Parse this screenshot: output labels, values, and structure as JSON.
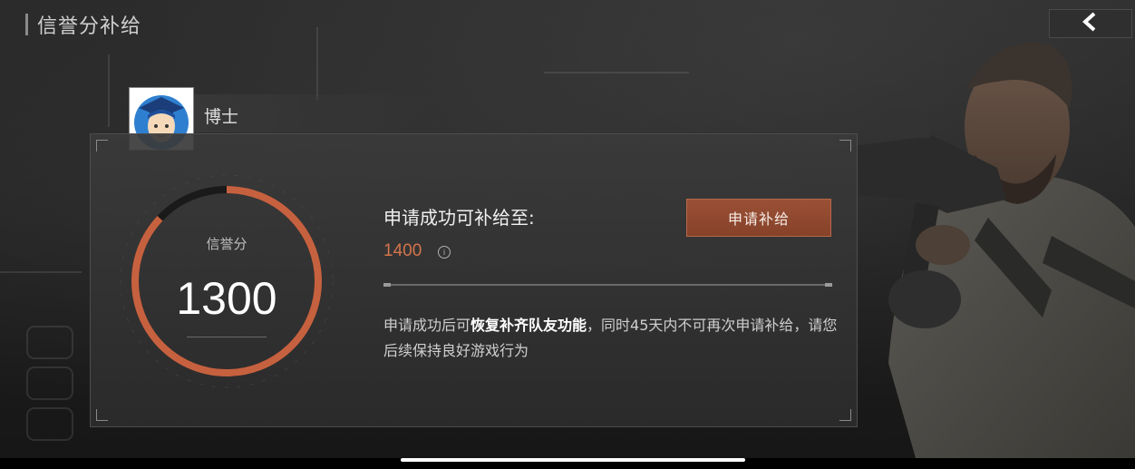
{
  "header": {
    "title": "信誉分补给",
    "back_icon": "chevron-left-icon"
  },
  "player": {
    "name": "博士",
    "avatar_icon": "doctor-avatar-icon"
  },
  "credit": {
    "label": "信誉分",
    "value": "1300",
    "progress_fraction": 0.87
  },
  "supply": {
    "title": "申请成功可补给至:",
    "value": "1400",
    "info_icon": "info-icon"
  },
  "apply_button": {
    "label": "申请补给"
  },
  "description": {
    "part1": "申请成功后可",
    "highlight": "恢复补齐队友功能",
    "part2": "，同时45天内不可再次申请补给，请您后续保持良好游戏行为"
  },
  "colors": {
    "accent": "#c6613f",
    "button": "#8f472d",
    "text_orange": "#d4744c"
  }
}
